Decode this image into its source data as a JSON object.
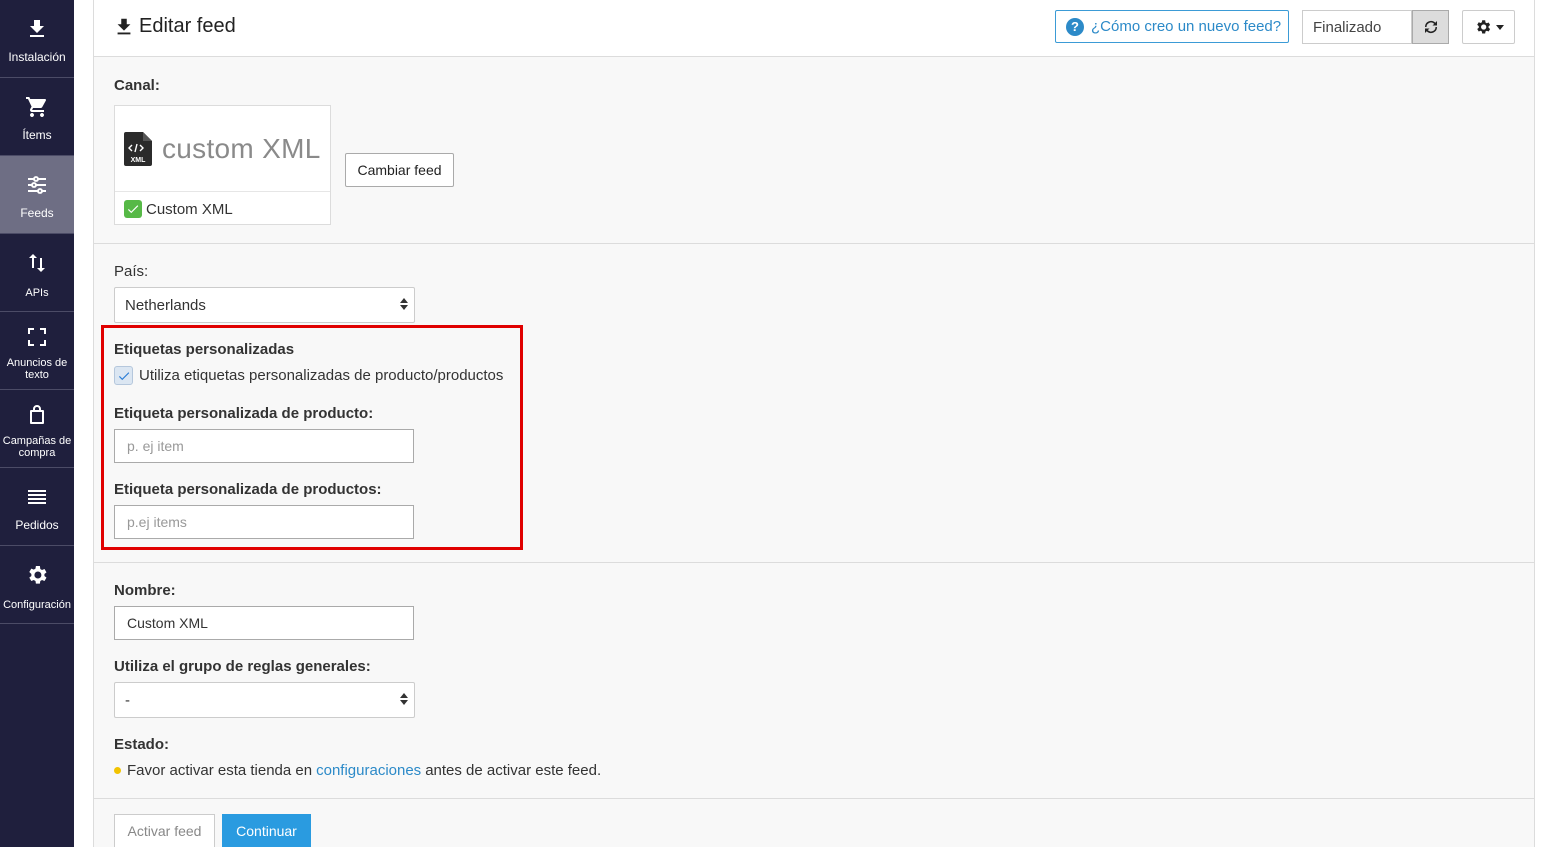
{
  "sidebar": {
    "items": [
      {
        "label": "Instalación",
        "icon": "download-icon"
      },
      {
        "label": "Ítems",
        "icon": "cart-icon"
      },
      {
        "label": "Feeds",
        "icon": "sliders-icon"
      },
      {
        "label": "APIs",
        "icon": "arrows-updown-icon"
      },
      {
        "label": "Anuncios de texto",
        "icon": "expand-icon"
      },
      {
        "label": "Campañas de compra",
        "icon": "shopping-bag-icon"
      },
      {
        "label": "Pedidos",
        "icon": "list-icon"
      },
      {
        "label": "Configuración",
        "icon": "gear-icon"
      }
    ],
    "active": "Feeds"
  },
  "header": {
    "title": "Editar feed",
    "help_label": "¿Cómo creo un nuevo feed?",
    "status_value": "Finalizado"
  },
  "channel": {
    "label": "Canal:",
    "logo_text": "custom XML",
    "file_badge": "XML",
    "name": "Custom XML",
    "change_button": "Cambiar feed"
  },
  "country": {
    "label": "País:",
    "selected": "Netherlands"
  },
  "custom_labels": {
    "section_title": "Etiquetas personalizadas",
    "checkbox_label": "Utiliza etiquetas personalizadas de producto/productos",
    "checkbox_checked": true,
    "singular_label": "Etiqueta personalizada de producto:",
    "singular_placeholder": "p. ej item",
    "plural_label": "Etiqueta personalizada de productos:",
    "plural_placeholder": "p.ej items"
  },
  "name": {
    "label": "Nombre:",
    "value": "Custom XML"
  },
  "rules": {
    "label": "Utiliza el grupo de reglas generales:",
    "selected": "-"
  },
  "status": {
    "label": "Estado:",
    "message_before": "Favor activar esta tienda en",
    "link_text": "configuraciones",
    "message_after": "antes de activar este feed."
  },
  "footer": {
    "activate_label": "Activar feed",
    "continue_label": "Continuar"
  },
  "colors": {
    "sidebar_bg": "#1f1f3d",
    "sidebar_active": "#6e6e84",
    "accent": "#2a9be0",
    "highlight": "#e00000",
    "status_dot": "#f2c300"
  }
}
